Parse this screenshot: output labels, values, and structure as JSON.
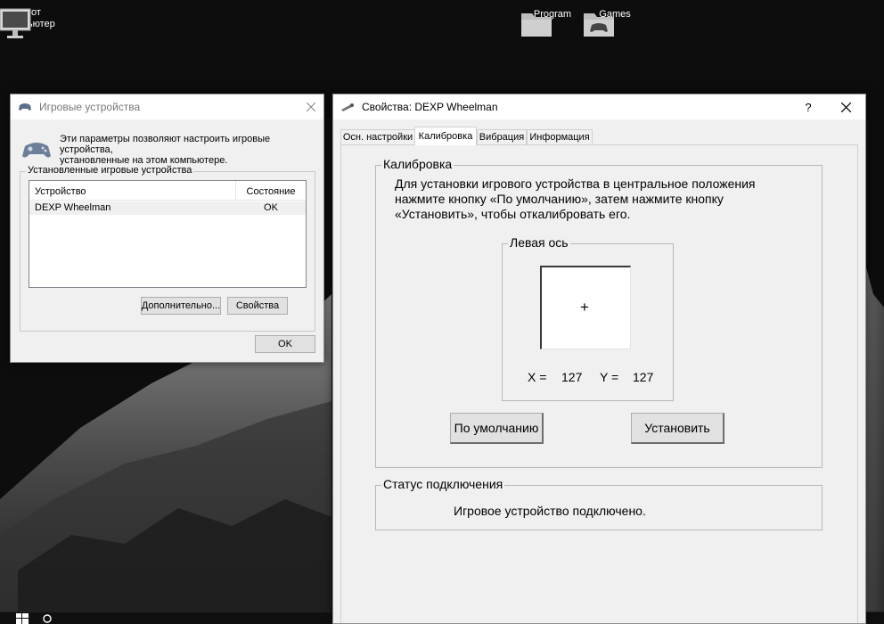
{
  "desktop": {
    "icons": [
      {
        "name": "this-computer",
        "label_line1": "Этот",
        "label_line2": "компьютер"
      },
      {
        "name": "program",
        "label": "Program"
      },
      {
        "name": "games",
        "label": "Games"
      }
    ]
  },
  "game_devices_window": {
    "title": "Игровые устройства",
    "description_line1": "Эти параметры позволяют настроить игровые устройства,",
    "description_line2": "установленные на этом компьютере.",
    "group_title": "Установленные игровые устройства",
    "columns": [
      "Устройство",
      "Состояние"
    ],
    "rows": [
      {
        "device": "DEXP Wheelman",
        "status": "OK"
      }
    ],
    "advanced_label": "Дополнительно...",
    "properties_label": "Свойства",
    "ok_label": "OK"
  },
  "properties_window": {
    "title": "Свойства: DEXP Wheelman",
    "help_label": "?",
    "close_label": "✕",
    "tabs": [
      {
        "label": "Осн. настройки",
        "active": false
      },
      {
        "label": "Калибровка",
        "active": true
      },
      {
        "label": "Вибрация",
        "active": false
      },
      {
        "label": "Информация",
        "active": false
      }
    ],
    "calibration": {
      "group_title": "Калибровка",
      "instruction_line1": "Для установки игрового устройства в центральное положения",
      "instruction_line2": "нажмите кнопку «По умолчанию», затем нажмите кнопку",
      "instruction_line3": "«Установить», чтобы откалибровать его.",
      "left_axis_title": "Левая ось",
      "crosshair": "+",
      "x_label": "X =",
      "x_value": "127",
      "y_label": "Y =",
      "y_value": "127",
      "default_button": "По умолчанию",
      "set_button": "Установить"
    },
    "status": {
      "group_title": "Статус подключения",
      "message": "Игровое устройство подключено."
    }
  }
}
